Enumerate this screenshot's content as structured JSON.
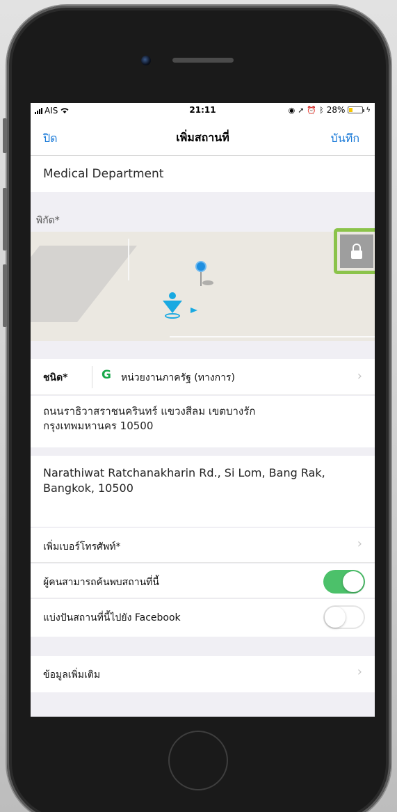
{
  "status_bar": {
    "carrier": "AIS",
    "time": "21:11",
    "battery": "28%",
    "battery_level": 0.28
  },
  "nav": {
    "close_label": "ปิด",
    "title": "เพิ่มสถานที่",
    "save_label": "บันทึก"
  },
  "place_name": "Medical Department",
  "coordinates_label": "พิกัด*",
  "type": {
    "label": "ชนิด*",
    "icon_glyph": "G",
    "value": "หน่วยงานภาครัฐ (ทางการ)"
  },
  "address_th": {
    "line1": "ถนนราธิวาสราชนครินทร์ แขวงสีลม เขตบางรัก",
    "line2": "กรุงเทพมหานคร 10500"
  },
  "address_en": {
    "line1": "Narathiwat Ratchanakharin Rd., Si Lom, Bang Rak,",
    "line2": "Bangkok, 10500"
  },
  "add_phone_label": "เพิ่มเบอร์โทรศัพท์*",
  "discoverable": {
    "label": "ผู้คนสามารถค้นพบสถานที่นี้",
    "on": true
  },
  "share_facebook": {
    "label": "แบ่งปันสถานที่นี้ไปยัง Facebook",
    "on": false
  },
  "more_info_label": "ข้อมูลเพิ่มเติม",
  "colors": {
    "accent": "#1a7ad8",
    "toggle_on": "#4cc16a",
    "highlight": "#8bc34a",
    "type_icon": "#19a84a"
  },
  "icons": [
    "signal-icon",
    "wifi-icon",
    "location-arrow-icon",
    "alarm-icon",
    "bluetooth-icon",
    "battery-icon",
    "map-pin-icon",
    "user-location-icon",
    "lock-icon",
    "chevron-right-icon"
  ]
}
